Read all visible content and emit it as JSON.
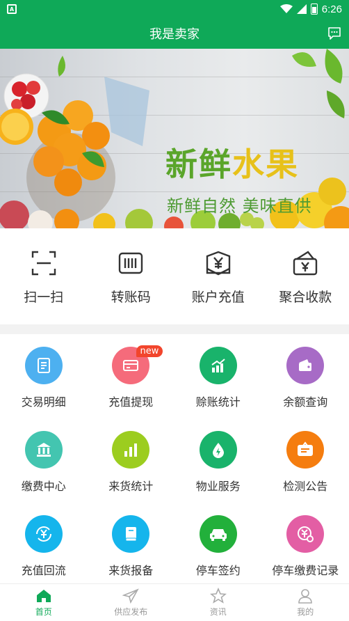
{
  "status_bar": {
    "time": "6:26",
    "signal_icon": "signal-icon",
    "wifi_icon": "wifi-icon",
    "battery_icon": "battery-icon"
  },
  "header": {
    "title": "我是卖家",
    "message_icon": "message-icon"
  },
  "banner": {
    "title_part1": "新鲜",
    "title_part2": "水果",
    "subtitle": "新鲜自然 美味直供"
  },
  "quick_actions": [
    {
      "label": "扫一扫",
      "icon": "scan-icon"
    },
    {
      "label": "转账码",
      "icon": "barcode-icon"
    },
    {
      "label": "账户充值",
      "icon": "account-recharge-icon"
    },
    {
      "label": "聚合收款",
      "icon": "wallet-collect-icon"
    }
  ],
  "grid": [
    {
      "label": "交易明细",
      "icon": "document-icon",
      "color": "#4db0f0"
    },
    {
      "label": "充值提现",
      "icon": "card-icon",
      "color": "#f56b7b",
      "badge": "new"
    },
    {
      "label": "赊账统计",
      "icon": "bar-chart-up-icon",
      "color": "#19b36b"
    },
    {
      "label": "余额查询",
      "icon": "wallet-icon",
      "color": "#a76bc6"
    },
    {
      "label": "缴费中心",
      "icon": "bank-icon",
      "color": "#43c5b0"
    },
    {
      "label": "来货统计",
      "icon": "bar-chart-icon",
      "color": "#9ccd1f"
    },
    {
      "label": "物业服务",
      "icon": "drop-bolt-icon",
      "color": "#19b36b"
    },
    {
      "label": "检测公告",
      "icon": "notice-board-icon",
      "color": "#f57d0f"
    },
    {
      "label": "充值回流",
      "icon": "yen-refresh-icon",
      "color": "#15b5ec"
    },
    {
      "label": "来货报备",
      "icon": "book-icon",
      "color": "#15b5ec"
    },
    {
      "label": "停车签约",
      "icon": "car-icon",
      "color": "#22b03b"
    },
    {
      "label": "停车缴费记录",
      "icon": "yen-clock-icon",
      "color": "#e35ea4"
    }
  ],
  "bottom_nav": [
    {
      "label": "首页",
      "icon": "home-icon",
      "active": true
    },
    {
      "label": "供应发布",
      "icon": "send-icon",
      "active": false
    },
    {
      "label": "资讯",
      "icon": "star-icon",
      "active": false
    },
    {
      "label": "我的",
      "icon": "user-icon",
      "active": false
    }
  ],
  "colors": {
    "primary": "#0fa958",
    "badge": "#f2452c"
  }
}
